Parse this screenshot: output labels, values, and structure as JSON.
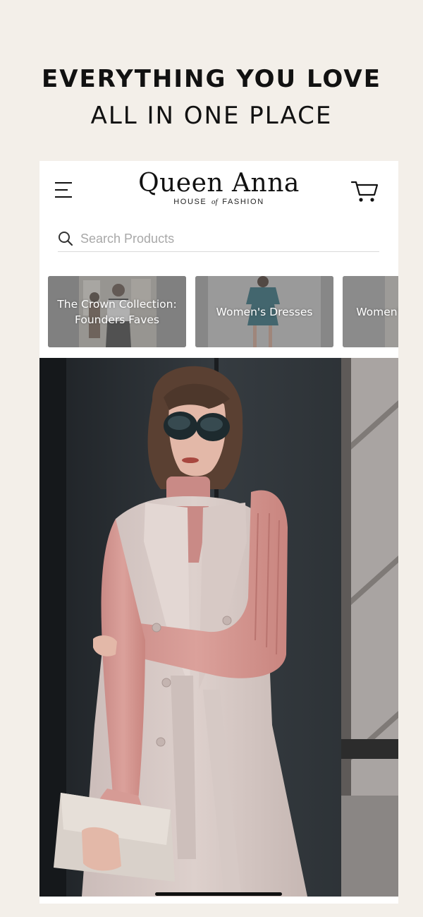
{
  "headline": {
    "line1": "EVERYTHING YOU LOVE",
    "line2": "ALL IN ONE PLACE"
  },
  "app": {
    "logo_main": "Queen Anna",
    "logo_sub_left": "HOUSE",
    "logo_sub_of": "of",
    "logo_sub_right": "FASHION"
  },
  "search": {
    "placeholder": "Search Products"
  },
  "categories": [
    {
      "label": "The Crown Collection: Founders Faves"
    },
    {
      "label": "Women's Dresses"
    },
    {
      "label": "Women's Sleeveless"
    }
  ],
  "icons": {
    "menu": "menu-icon",
    "cart": "cart-icon",
    "search": "search-icon"
  },
  "colors": {
    "page_background": "#f3efe9",
    "app_background": "#ffffff",
    "text": "#111111",
    "search_placeholder": "#a8a8a8"
  }
}
